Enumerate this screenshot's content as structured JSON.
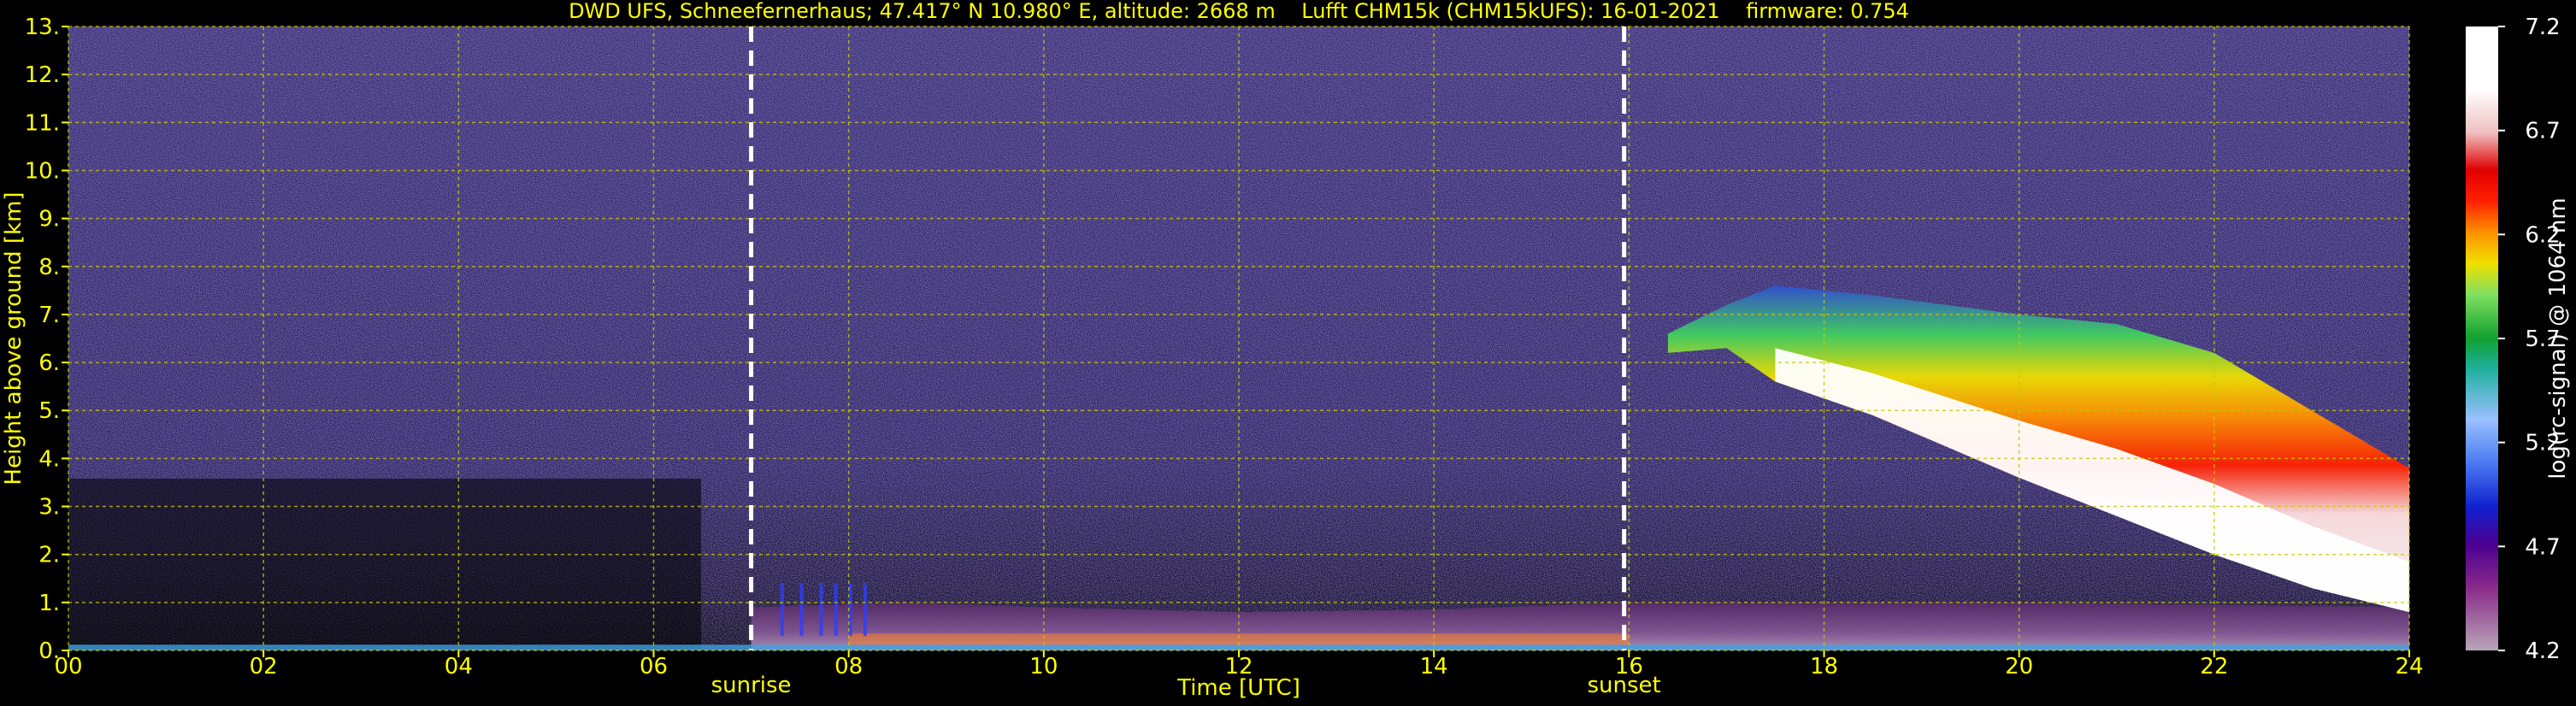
{
  "chart_data": {
    "type": "heatmap",
    "title": "DWD UFS, Schneefernerhaus; 47.417° N 10.980° E, altitude: 2668 m    Lufft CHM15k (CHM15kUFS): 16-01-2021    firmware: 0.754",
    "xlabel": "Time [UTC]",
    "ylabel": "Height above ground [km]",
    "xlim": [
      0,
      24
    ],
    "ylim": [
      0,
      13
    ],
    "xticks": [
      "00",
      "02",
      "04",
      "06",
      "08",
      "10",
      "12",
      "14",
      "16",
      "18",
      "20",
      "22",
      "24"
    ],
    "yticks": [
      "0.",
      "1.",
      "2.",
      "3.",
      "4.",
      "5.",
      "6.",
      "7.",
      "8.",
      "9.",
      "10.",
      "11.",
      "12.",
      "13."
    ],
    "grid": true,
    "event_lines": [
      {
        "label": "sunrise",
        "x": 7.0
      },
      {
        "label": "sunset",
        "x": 15.95
      }
    ],
    "colorbar": {
      "label": "log(rc-signal) @ 1064 nm",
      "range": [
        4.2,
        7.2
      ],
      "ticks": [
        "4.2",
        "4.7",
        "5.2",
        "5.7",
        "6.2",
        "6.7",
        "7.2"
      ]
    },
    "cloud_layer": {
      "description_points": [
        {
          "x": 16.4,
          "base": 6.2,
          "top": 6.6
        },
        {
          "x": 17.0,
          "base": 6.3,
          "top": 7.2
        },
        {
          "x": 17.5,
          "base": 5.6,
          "top": 7.6
        },
        {
          "x": 18.5,
          "base": 4.9,
          "top": 7.4
        },
        {
          "x": 20.0,
          "base": 3.6,
          "top": 7.0
        },
        {
          "x": 21.0,
          "base": 2.8,
          "top": 6.8
        },
        {
          "x": 22.0,
          "base": 2.0,
          "top": 6.2
        },
        {
          "x": 23.0,
          "base": 1.3,
          "top": 5.0
        },
        {
          "x": 24.0,
          "base": 0.8,
          "top": 3.8
        }
      ]
    }
  },
  "colors": {
    "text": "#ffff00",
    "grid": "#c8c800",
    "background_noise": "#3a2a6a",
    "event_line": "#ffffff"
  }
}
